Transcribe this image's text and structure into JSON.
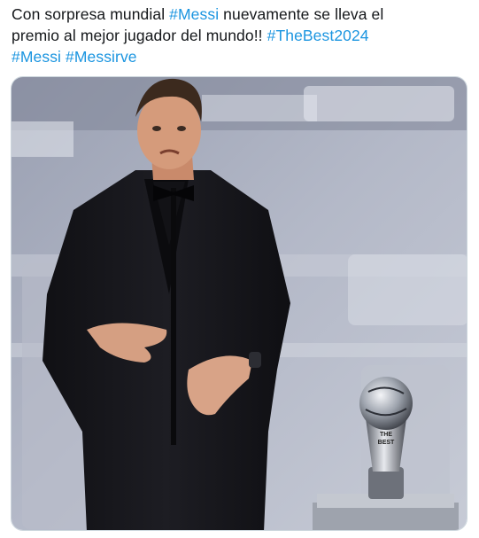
{
  "tweet": {
    "text_lines": [
      [
        {
          "text": "Con sorpresa mundial ",
          "type": "text"
        },
        {
          "text": "#Messi",
          "type": "hashtag"
        },
        {
          "text": " nuevamente se lleva el",
          "type": "text"
        }
      ],
      [
        {
          "text": "premio al mejor jugador del mundo!! ",
          "type": "text"
        },
        {
          "text": "#TheBest2024",
          "type": "hashtag"
        }
      ],
      [
        {
          "text": "#Messi",
          "type": "hashtag"
        },
        {
          "text": " ",
          "type": "text"
        },
        {
          "text": "#Messirve",
          "type": "hashtag"
        }
      ]
    ],
    "media": {
      "trophy_label_line1": "THE",
      "trophy_label_line2": "BEST"
    }
  },
  "colors": {
    "hashtag": "#1b95e0",
    "text": "#14171a",
    "suit": "#16161a",
    "stage_bg": "#aab0c0"
  }
}
